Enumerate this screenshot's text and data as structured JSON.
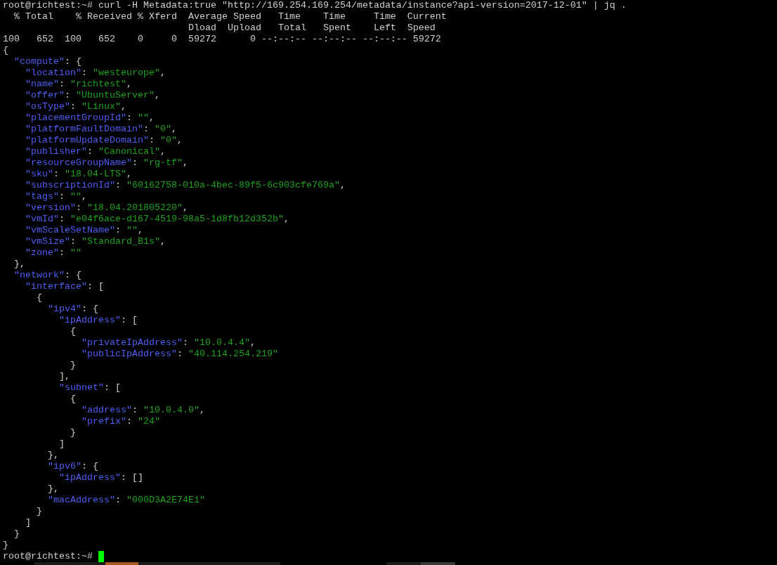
{
  "terminal": {
    "lines": [
      {
        "segments": [
          {
            "kind": "plain",
            "text": "root@richtest:~# curl -H Metadata:true \"http://169.254.169.254/metadata/instance?api-version=2017-12-01\" | jq ."
          }
        ]
      },
      {
        "segments": [
          {
            "kind": "plain",
            "text": "  % Total    % Received % Xferd  Average Speed   Time    Time     Time  Current"
          }
        ]
      },
      {
        "segments": [
          {
            "kind": "plain",
            "text": "                                 Dload  Upload   Total   Spent    Left  Speed"
          }
        ]
      },
      {
        "segments": [
          {
            "kind": "plain",
            "text": "100   652  100   652    0     0  59272      0 --:--:-- --:--:-- --:--:-- 59272"
          }
        ]
      },
      {
        "segments": [
          {
            "kind": "plain",
            "text": "{"
          }
        ]
      },
      {
        "segments": [
          {
            "kind": "key",
            "text": "  \"compute\""
          },
          {
            "kind": "plain",
            "text": ": {"
          }
        ]
      },
      {
        "segments": [
          {
            "kind": "key",
            "text": "    \"location\""
          },
          {
            "kind": "plain",
            "text": ": "
          },
          {
            "kind": "string",
            "text": "\"westeurope\""
          },
          {
            "kind": "plain",
            "text": ","
          }
        ]
      },
      {
        "segments": [
          {
            "kind": "key",
            "text": "    \"name\""
          },
          {
            "kind": "plain",
            "text": ": "
          },
          {
            "kind": "string",
            "text": "\"richtest\""
          },
          {
            "kind": "plain",
            "text": ","
          }
        ]
      },
      {
        "segments": [
          {
            "kind": "key",
            "text": "    \"offer\""
          },
          {
            "kind": "plain",
            "text": ": "
          },
          {
            "kind": "string",
            "text": "\"UbuntuServer\""
          },
          {
            "kind": "plain",
            "text": ","
          }
        ]
      },
      {
        "segments": [
          {
            "kind": "key",
            "text": "    \"osType\""
          },
          {
            "kind": "plain",
            "text": ": "
          },
          {
            "kind": "string",
            "text": "\"Linux\""
          },
          {
            "kind": "plain",
            "text": ","
          }
        ]
      },
      {
        "segments": [
          {
            "kind": "key",
            "text": "    \"placementGroupId\""
          },
          {
            "kind": "plain",
            "text": ": "
          },
          {
            "kind": "string",
            "text": "\"\""
          },
          {
            "kind": "plain",
            "text": ","
          }
        ]
      },
      {
        "segments": [
          {
            "kind": "key",
            "text": "    \"platformFaultDomain\""
          },
          {
            "kind": "plain",
            "text": ": "
          },
          {
            "kind": "string",
            "text": "\"0\""
          },
          {
            "kind": "plain",
            "text": ","
          }
        ]
      },
      {
        "segments": [
          {
            "kind": "key",
            "text": "    \"platformUpdateDomain\""
          },
          {
            "kind": "plain",
            "text": ": "
          },
          {
            "kind": "string",
            "text": "\"0\""
          },
          {
            "kind": "plain",
            "text": ","
          }
        ]
      },
      {
        "segments": [
          {
            "kind": "key",
            "text": "    \"publisher\""
          },
          {
            "kind": "plain",
            "text": ": "
          },
          {
            "kind": "string",
            "text": "\"Canonical\""
          },
          {
            "kind": "plain",
            "text": ","
          }
        ]
      },
      {
        "segments": [
          {
            "kind": "key",
            "text": "    \"resourceGroupName\""
          },
          {
            "kind": "plain",
            "text": ": "
          },
          {
            "kind": "string",
            "text": "\"rg-tf\""
          },
          {
            "kind": "plain",
            "text": ","
          }
        ]
      },
      {
        "segments": [
          {
            "kind": "key",
            "text": "    \"sku\""
          },
          {
            "kind": "plain",
            "text": ": "
          },
          {
            "kind": "string",
            "text": "\"18.04-LTS\""
          },
          {
            "kind": "plain",
            "text": ","
          }
        ]
      },
      {
        "segments": [
          {
            "kind": "key",
            "text": "    \"subscriptionId\""
          },
          {
            "kind": "plain",
            "text": ": "
          },
          {
            "kind": "string",
            "text": "\"60162758-010a-4bec-89f5-6c903cfe769a\""
          },
          {
            "kind": "plain",
            "text": ","
          }
        ]
      },
      {
        "segments": [
          {
            "kind": "key",
            "text": "    \"tags\""
          },
          {
            "kind": "plain",
            "text": ": "
          },
          {
            "kind": "string",
            "text": "\"\""
          },
          {
            "kind": "plain",
            "text": ","
          }
        ]
      },
      {
        "segments": [
          {
            "kind": "key",
            "text": "    \"version\""
          },
          {
            "kind": "plain",
            "text": ": "
          },
          {
            "kind": "string",
            "text": "\"18.04.201805220\""
          },
          {
            "kind": "plain",
            "text": ","
          }
        ]
      },
      {
        "segments": [
          {
            "kind": "key",
            "text": "    \"vmId\""
          },
          {
            "kind": "plain",
            "text": ": "
          },
          {
            "kind": "string",
            "text": "\"e04f6ace-d167-4519-98a5-1d8fb12d352b\""
          },
          {
            "kind": "plain",
            "text": ","
          }
        ]
      },
      {
        "segments": [
          {
            "kind": "key",
            "text": "    \"vmScaleSetName\""
          },
          {
            "kind": "plain",
            "text": ": "
          },
          {
            "kind": "string",
            "text": "\"\""
          },
          {
            "kind": "plain",
            "text": ","
          }
        ]
      },
      {
        "segments": [
          {
            "kind": "key",
            "text": "    \"vmSize\""
          },
          {
            "kind": "plain",
            "text": ": "
          },
          {
            "kind": "string",
            "text": "\"Standard_B1s\""
          },
          {
            "kind": "plain",
            "text": ","
          }
        ]
      },
      {
        "segments": [
          {
            "kind": "key",
            "text": "    \"zone\""
          },
          {
            "kind": "plain",
            "text": ": "
          },
          {
            "kind": "string",
            "text": "\"\""
          }
        ]
      },
      {
        "segments": [
          {
            "kind": "plain",
            "text": "  },"
          }
        ]
      },
      {
        "segments": [
          {
            "kind": "key",
            "text": "  \"network\""
          },
          {
            "kind": "plain",
            "text": ": {"
          }
        ]
      },
      {
        "segments": [
          {
            "kind": "key",
            "text": "    \"interface\""
          },
          {
            "kind": "plain",
            "text": ": ["
          }
        ]
      },
      {
        "segments": [
          {
            "kind": "plain",
            "text": "      {"
          }
        ]
      },
      {
        "segments": [
          {
            "kind": "key",
            "text": "        \"ipv4\""
          },
          {
            "kind": "plain",
            "text": ": {"
          }
        ]
      },
      {
        "segments": [
          {
            "kind": "key",
            "text": "          \"ipAddress\""
          },
          {
            "kind": "plain",
            "text": ": ["
          }
        ]
      },
      {
        "segments": [
          {
            "kind": "plain",
            "text": "            {"
          }
        ]
      },
      {
        "segments": [
          {
            "kind": "key",
            "text": "              \"privateIpAddress\""
          },
          {
            "kind": "plain",
            "text": ": "
          },
          {
            "kind": "string",
            "text": "\"10.0.4.4\""
          },
          {
            "kind": "plain",
            "text": ","
          }
        ]
      },
      {
        "segments": [
          {
            "kind": "key",
            "text": "              \"publicIpAddress\""
          },
          {
            "kind": "plain",
            "text": ": "
          },
          {
            "kind": "string",
            "text": "\"40.114.254.219\""
          }
        ]
      },
      {
        "segments": [
          {
            "kind": "plain",
            "text": "            }"
          }
        ]
      },
      {
        "segments": [
          {
            "kind": "plain",
            "text": "          ],"
          }
        ]
      },
      {
        "segments": [
          {
            "kind": "key",
            "text": "          \"subnet\""
          },
          {
            "kind": "plain",
            "text": ": ["
          }
        ]
      },
      {
        "segments": [
          {
            "kind": "plain",
            "text": "            {"
          }
        ]
      },
      {
        "segments": [
          {
            "kind": "key",
            "text": "              \"address\""
          },
          {
            "kind": "plain",
            "text": ": "
          },
          {
            "kind": "string",
            "text": "\"10.0.4.0\""
          },
          {
            "kind": "plain",
            "text": ","
          }
        ]
      },
      {
        "segments": [
          {
            "kind": "key",
            "text": "              \"prefix\""
          },
          {
            "kind": "plain",
            "text": ": "
          },
          {
            "kind": "string",
            "text": "\"24\""
          }
        ]
      },
      {
        "segments": [
          {
            "kind": "plain",
            "text": "            }"
          }
        ]
      },
      {
        "segments": [
          {
            "kind": "plain",
            "text": "          ]"
          }
        ]
      },
      {
        "segments": [
          {
            "kind": "plain",
            "text": "        },"
          }
        ]
      },
      {
        "segments": [
          {
            "kind": "key",
            "text": "        \"ipv6\""
          },
          {
            "kind": "plain",
            "text": ": {"
          }
        ]
      },
      {
        "segments": [
          {
            "kind": "key",
            "text": "          \"ipAddress\""
          },
          {
            "kind": "plain",
            "text": ": []"
          }
        ]
      },
      {
        "segments": [
          {
            "kind": "plain",
            "text": "        },"
          }
        ]
      },
      {
        "segments": [
          {
            "kind": "key",
            "text": "        \"macAddress\""
          },
          {
            "kind": "plain",
            "text": ": "
          },
          {
            "kind": "string",
            "text": "\"000D3A2E74E1\""
          }
        ]
      },
      {
        "segments": [
          {
            "kind": "plain",
            "text": "      }"
          }
        ]
      },
      {
        "segments": [
          {
            "kind": "plain",
            "text": "    ]"
          }
        ]
      },
      {
        "segments": [
          {
            "kind": "plain",
            "text": "  }"
          }
        ]
      },
      {
        "segments": [
          {
            "kind": "plain",
            "text": "}"
          }
        ]
      },
      {
        "segments": [
          {
            "kind": "plain",
            "text": "root@richtest:~# "
          }
        ],
        "cursor": true
      }
    ]
  }
}
